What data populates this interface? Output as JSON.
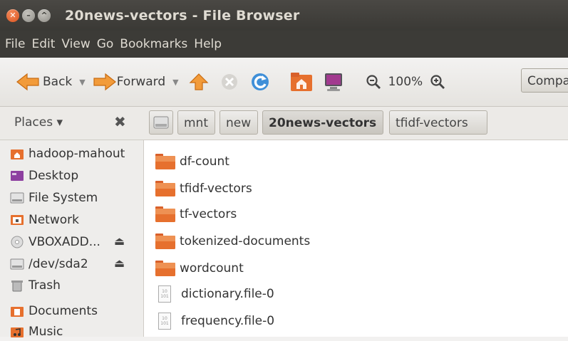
{
  "window": {
    "title": "20news-vectors - File Browser"
  },
  "menu": [
    "File",
    "Edit",
    "View",
    "Go",
    "Bookmarks",
    "Help"
  ],
  "toolbar": {
    "back_label": "Back",
    "forward_label": "Forward",
    "zoom_label": "100%",
    "compact_label": "Compact"
  },
  "places": {
    "header": "Places ▾"
  },
  "breadcrumb": [
    "mnt",
    "new",
    "20news-vectors",
    "tfidf-vectors"
  ],
  "sidebar": {
    "items": [
      {
        "label": "hadoop-mahout",
        "icon": "home-folder-icon"
      },
      {
        "label": "Desktop",
        "icon": "desktop-icon"
      },
      {
        "label": "File System",
        "icon": "drive-icon"
      },
      {
        "label": "Network",
        "icon": "network-icon"
      },
      {
        "label": "VBOXADD...",
        "icon": "cdrom-icon"
      },
      {
        "label": "/dev/sda2",
        "icon": "drive-icon"
      },
      {
        "label": "Trash",
        "icon": "trash-icon"
      },
      {
        "label": "Documents",
        "icon": "documents-folder-icon"
      },
      {
        "label": "Music",
        "icon": "music-folder-icon"
      }
    ]
  },
  "files": [
    {
      "name": "df-count",
      "type": "folder"
    },
    {
      "name": "tfidf-vectors",
      "type": "folder"
    },
    {
      "name": "tf-vectors",
      "type": "folder"
    },
    {
      "name": "tokenized-documents",
      "type": "folder"
    },
    {
      "name": "wordcount",
      "type": "folder"
    },
    {
      "name": "dictionary.file-0",
      "type": "binary-file"
    },
    {
      "name": "frequency.file-0",
      "type": "binary-file"
    }
  ],
  "colors": {
    "folder": "#e6702e",
    "titlebar": "#3c3b37",
    "accent": "#dd4814"
  }
}
